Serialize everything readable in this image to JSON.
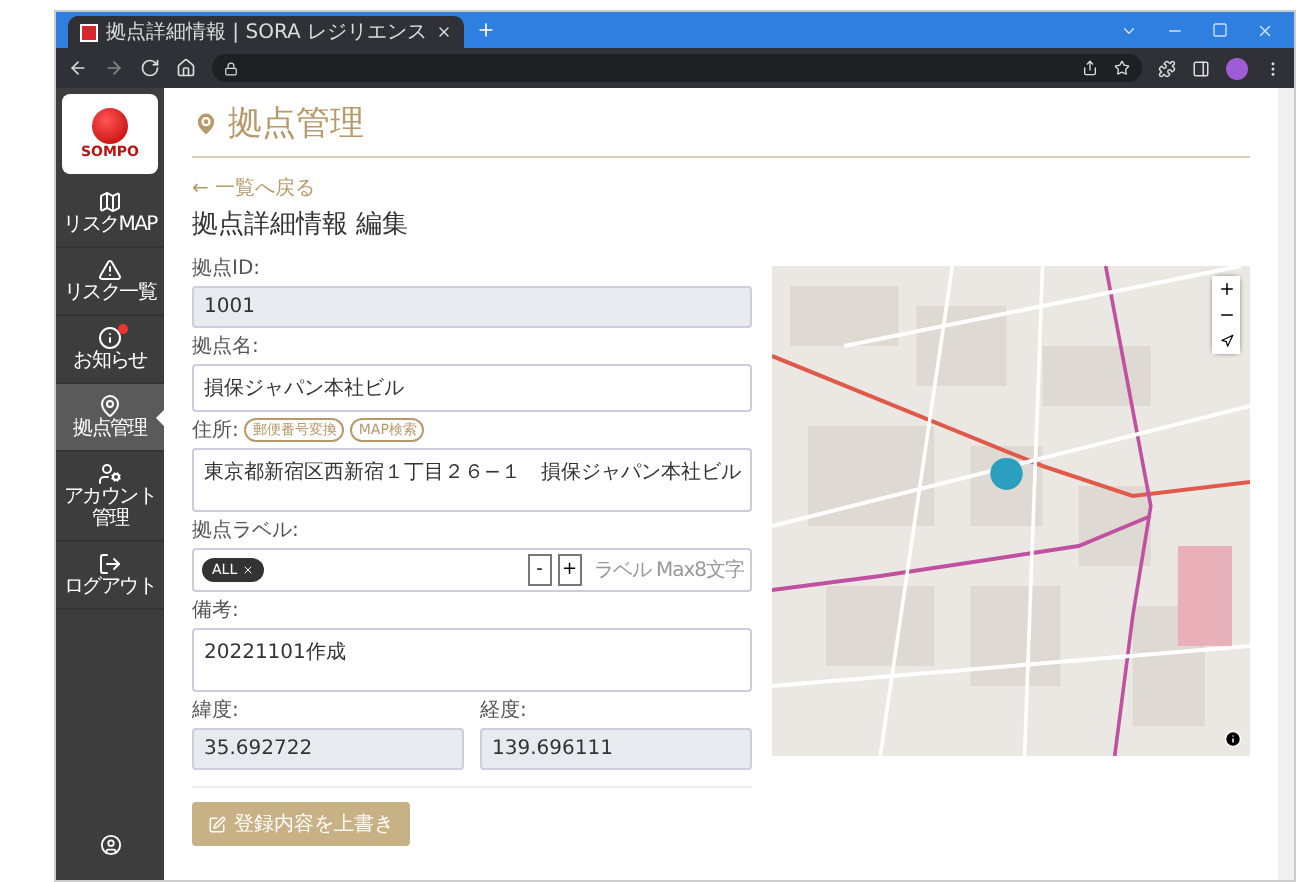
{
  "browser": {
    "tab_title": "拠点詳細情報 | SORA レジリエンス"
  },
  "sidebar": {
    "logo": "SOMPO",
    "items": [
      {
        "kind": "map",
        "label": "リスクMAP",
        "selected": false,
        "badge": false
      },
      {
        "kind": "alert",
        "label": "リスク一覧",
        "selected": false,
        "badge": false
      },
      {
        "kind": "info",
        "label": "お知らせ",
        "selected": false,
        "badge": true
      },
      {
        "kind": "pin",
        "label": "拠点管理",
        "selected": true,
        "badge": false
      },
      {
        "kind": "account",
        "label": "アカウント管理",
        "selected": false,
        "badge": false
      },
      {
        "kind": "logout",
        "label": "ログアウト",
        "selected": false,
        "badge": false
      }
    ]
  },
  "page_title": "拠点管理",
  "back_link": "← 一覧へ戻る",
  "heading": "拠点詳細情報 編集",
  "fields": [
    {
      "kind": "input",
      "label": "拠点ID:",
      "value": "1001",
      "readonly": true
    },
    {
      "kind": "input",
      "label": "拠点名:",
      "value": "損保ジャパン本社ビル",
      "readonly": false
    },
    {
      "kind": "textarea",
      "label": "住所:",
      "buttons": [
        "郵便番号変換",
        "MAP検索"
      ],
      "value": "東京都新宿区西新宿１丁目２６−１　損保ジャパン本社ビル"
    },
    {
      "kind": "tags",
      "label": "拠点ラベル:",
      "tags": [
        "ALL"
      ],
      "tag_buttons": [
        "-",
        "+"
      ],
      "placeholder": "ラベル Max8文字"
    },
    {
      "kind": "textarea",
      "label": "備考:",
      "value": "20221101作成"
    }
  ],
  "coordinates": [
    {
      "label": "緯度:",
      "value": "35.692722",
      "readonly": true
    },
    {
      "label": "経度:",
      "value": "139.696111",
      "readonly": true
    }
  ],
  "submit": "登録内容を上書き"
}
